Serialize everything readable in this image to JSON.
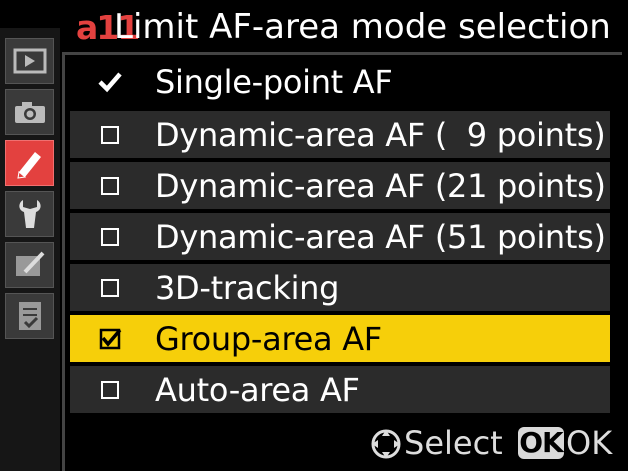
{
  "header": {
    "code": "a11",
    "title": "Limit AF-area mode selection"
  },
  "sidebar": {
    "tabs": [
      {
        "icon": "playback-icon",
        "active": false
      },
      {
        "icon": "camera-icon",
        "active": false
      },
      {
        "icon": "pencil-icon",
        "active": true
      },
      {
        "icon": "wrench-icon",
        "active": false
      },
      {
        "icon": "retouch-icon",
        "active": false
      },
      {
        "icon": "my-menu-icon",
        "active": false
      }
    ]
  },
  "menu": {
    "items": [
      {
        "label": "Single-point AF",
        "mark": "checkmark",
        "highlighted": false
      },
      {
        "label": "Dynamic-area AF (  9 points)",
        "mark": "checkbox",
        "checked": false,
        "highlighted": false
      },
      {
        "label": "Dynamic-area AF (21 points)",
        "mark": "checkbox",
        "checked": false,
        "highlighted": false
      },
      {
        "label": "Dynamic-area AF (51 points)",
        "mark": "checkbox",
        "checked": false,
        "highlighted": false
      },
      {
        "label": "3D-tracking",
        "mark": "checkbox",
        "checked": false,
        "highlighted": false
      },
      {
        "label": "Group-area AF",
        "mark": "checkbox",
        "checked": true,
        "highlighted": true
      },
      {
        "label": "Auto-area AF",
        "mark": "checkbox",
        "checked": false,
        "highlighted": false
      }
    ]
  },
  "footer": {
    "select_label": "Select",
    "ok_badge": "OK",
    "ok_label": "OK"
  },
  "colors": {
    "accent": "#e3413f",
    "highlight": "#f6cf0a",
    "row": "#2b2b2b"
  }
}
